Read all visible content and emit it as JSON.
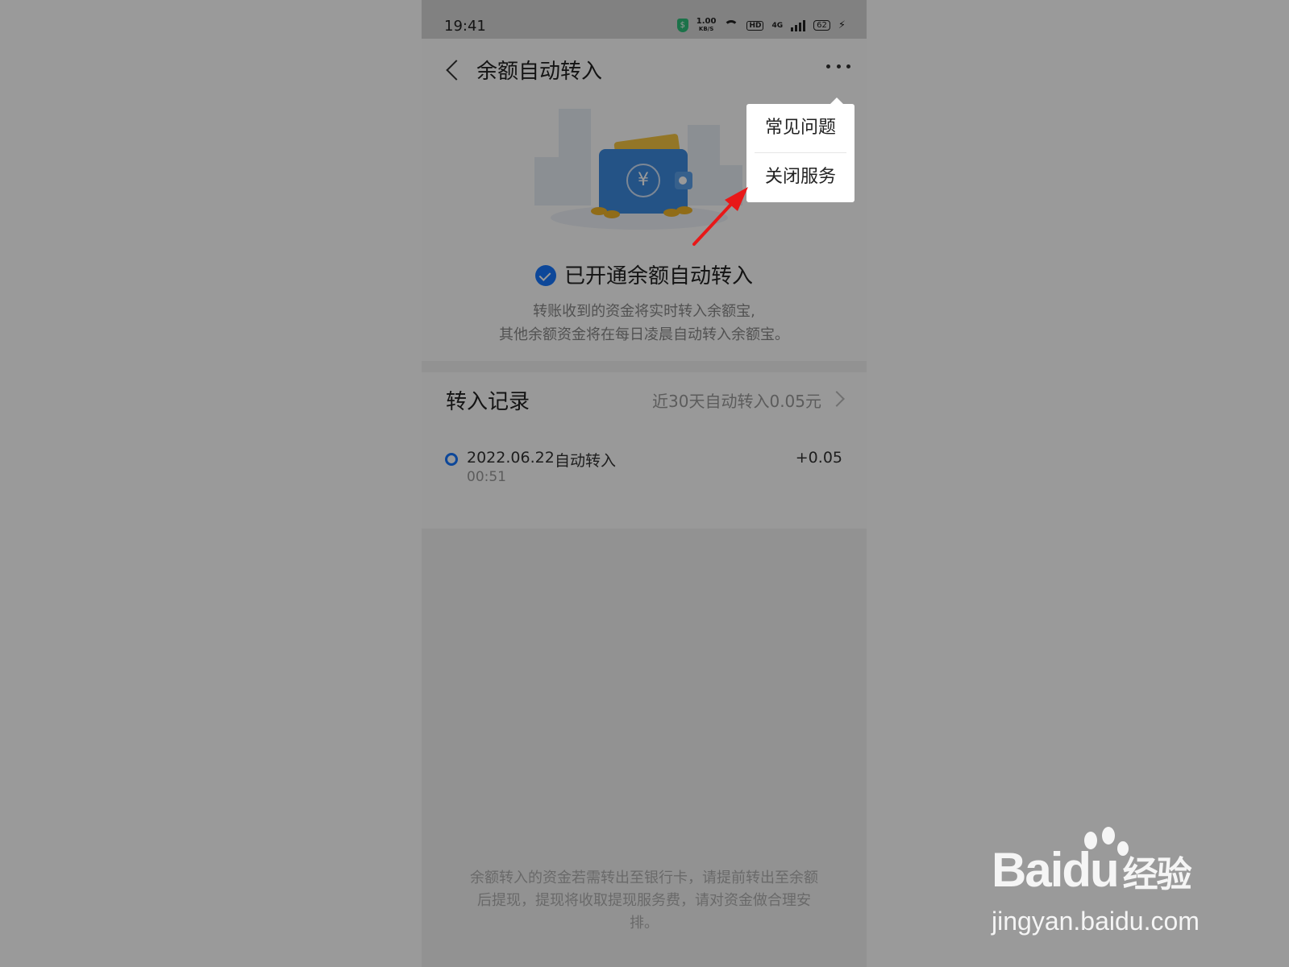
{
  "statusbar": {
    "time": "19:41",
    "netspeed_value": "1.00",
    "netspeed_unit": "KB/S",
    "hd": "HD",
    "network": "4G",
    "battery": "62"
  },
  "appbar": {
    "title": "余额自动转入"
  },
  "service": {
    "status": "已开通余额自动转入",
    "desc_line1": "转账收到的资金将实时转入余额宝,",
    "desc_line2": "其他余额资金将在每日凌晨自动转入余额宝。"
  },
  "records": {
    "title": "转入记录",
    "summary": "近30天自动转入0.05元",
    "items": [
      {
        "date": "2022.06.22",
        "type": "自动转入",
        "time": "00:51",
        "amount": "+0.05"
      }
    ]
  },
  "footer_note": "余额转入的资金若需转出至银行卡，请提前转出至余额后提现，提现将收取提现服务费，请对资金做合理安排。",
  "menu": {
    "items": [
      {
        "label": "常见问题"
      },
      {
        "label": "关闭服务"
      }
    ]
  },
  "watermark": {
    "brand": "Baidu",
    "cn": "经验",
    "url": "jingyan.baidu.com"
  },
  "colors": {
    "accent": "#1677ff",
    "overlay": "rgba(0,0,0,0.4)",
    "annotation_arrow": "#e81818"
  }
}
